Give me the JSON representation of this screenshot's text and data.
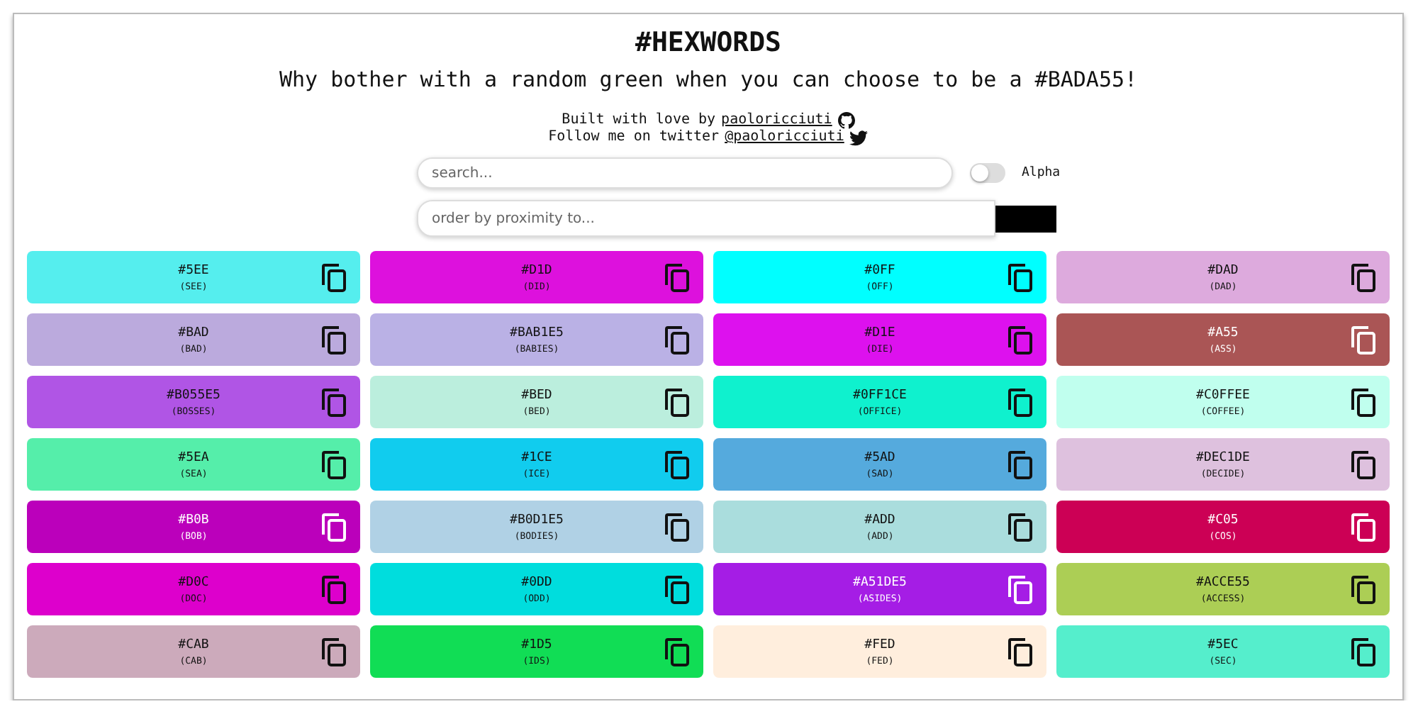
{
  "header": {
    "title": "#HEXWORDS",
    "tagline": "Why bother with a random green when you can choose to be a #BADA55!",
    "credit": {
      "text": "Built with love by",
      "link": "paoloricciuti"
    },
    "follow": {
      "text": "Follow me on twitter",
      "link": "@paoloricciuti"
    }
  },
  "search": {
    "placeholder": "search..."
  },
  "alpha": {
    "label": "Alpha",
    "on": false
  },
  "proximity": {
    "placeholder": "order by proximity to...",
    "color": "#000000"
  },
  "cards": [
    {
      "hex": "#5EE",
      "word": "(SEE)",
      "color": "#55eeee"
    },
    {
      "hex": "#D1D",
      "word": "(DID)",
      "color": "#dd11dd"
    },
    {
      "hex": "#0FF",
      "word": "(OFF)",
      "color": "#00ffff"
    },
    {
      "hex": "#DAD",
      "word": "(DAD)",
      "color": "#ddaadd"
    },
    {
      "hex": "#BAD",
      "word": "(BAD)",
      "color": "#bbaadd"
    },
    {
      "hex": "#BAB1E5",
      "word": "(BABIES)",
      "color": "#bab1e5"
    },
    {
      "hex": "#D1E",
      "word": "(DIE)",
      "color": "#dd11ee"
    },
    {
      "hex": "#A55",
      "word": "(ASS)",
      "color": "#aa5555"
    },
    {
      "hex": "#B055E5",
      "word": "(BOSSES)",
      "color": "#b055e5"
    },
    {
      "hex": "#BED",
      "word": "(BED)",
      "color": "#bbeedd"
    },
    {
      "hex": "#0FF1CE",
      "word": "(OFFICE)",
      "color": "#0ff1ce"
    },
    {
      "hex": "#C0FFEE",
      "word": "(COFFEE)",
      "color": "#c0ffee"
    },
    {
      "hex": "#5EA",
      "word": "(SEA)",
      "color": "#55eeaa"
    },
    {
      "hex": "#1CE",
      "word": "(ICE)",
      "color": "#11ccee"
    },
    {
      "hex": "#5AD",
      "word": "(SAD)",
      "color": "#55aadd"
    },
    {
      "hex": "#DEC1DE",
      "word": "(DECIDE)",
      "color": "#dec1de"
    },
    {
      "hex": "#B0B",
      "word": "(BOB)",
      "color": "#bb00bb"
    },
    {
      "hex": "#B0D1E5",
      "word": "(BODIES)",
      "color": "#b0d1e5"
    },
    {
      "hex": "#ADD",
      "word": "(ADD)",
      "color": "#aadddd"
    },
    {
      "hex": "#C05",
      "word": "(COS)",
      "color": "#cc0055"
    },
    {
      "hex": "#D0C",
      "word": "(DOC)",
      "color": "#dd00cc"
    },
    {
      "hex": "#0DD",
      "word": "(ODD)",
      "color": "#00dddd"
    },
    {
      "hex": "#A51DE5",
      "word": "(ASIDES)",
      "color": "#a51de5"
    },
    {
      "hex": "#ACCE55",
      "word": "(ACCESS)",
      "color": "#acce55"
    },
    {
      "hex": "#CAB",
      "word": "(CAB)",
      "color": "#ccaabb"
    },
    {
      "hex": "#1D5",
      "word": "(IDS)",
      "color": "#11dd55"
    },
    {
      "hex": "#FED",
      "word": "(FED)",
      "color": "#ffeedd"
    },
    {
      "hex": "#5EC",
      "word": "(SEC)",
      "color": "#55eecc"
    }
  ]
}
